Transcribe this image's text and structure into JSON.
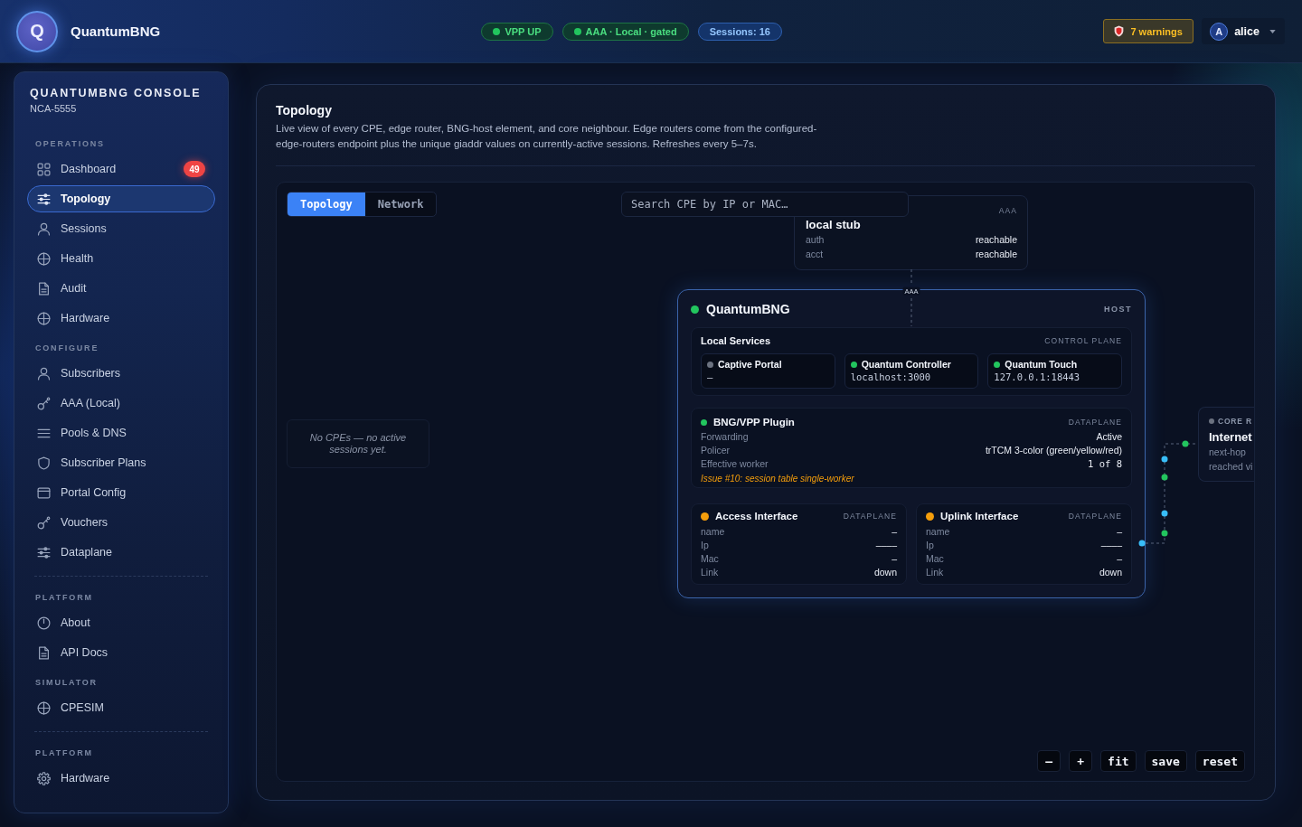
{
  "header": {
    "logo_letter": "Q",
    "brand": "QuantumBNG",
    "status_pills": [
      {
        "label": "VPP UP",
        "kind": "ok"
      },
      {
        "label": "AAA · Local · gated",
        "kind": "ok"
      },
      {
        "label": "Sessions: 16",
        "kind": "info"
      }
    ],
    "warnings": {
      "label": "7 warnings"
    },
    "user": {
      "initial": "A",
      "name": "alice"
    }
  },
  "sidebar": {
    "title": "QUANTUMBNG CONSOLE",
    "subtitle": "NCA-5555",
    "sections": [
      {
        "label": "OPERATIONS",
        "items": [
          {
            "label": "Dashboard",
            "selected": false,
            "badge": "49"
          },
          {
            "label": "Topology",
            "selected": true
          },
          {
            "label": "Sessions",
            "selected": false
          },
          {
            "label": "Health",
            "selected": false
          },
          {
            "label": "Audit",
            "selected": false
          },
          {
            "label": "Hardware",
            "selected": false
          }
        ]
      },
      {
        "label": "CONFIGURE",
        "items": [
          {
            "label": "Subscribers",
            "selected": false
          },
          {
            "label": "AAA (Local)",
            "selected": false
          },
          {
            "label": "Pools & DNS",
            "selected": false
          },
          {
            "label": "Subscriber Plans",
            "selected": false
          },
          {
            "label": "Portal Config",
            "selected": false
          },
          {
            "label": "Vouchers",
            "selected": false
          },
          {
            "label": "Dataplane",
            "selected": false
          }
        ]
      },
      {
        "label": "PLATFORM",
        "items": [
          {
            "label": "About",
            "selected": false
          },
          {
            "label": "API Docs",
            "selected": false
          }
        ]
      },
      {
        "label": "SIMULATOR",
        "items": [
          {
            "label": "CPESIM",
            "selected": false
          }
        ]
      },
      {
        "label": "PLATFORM",
        "items": [
          {
            "label": "Hardware",
            "selected": false
          }
        ]
      }
    ]
  },
  "topology": {
    "title": "Topology",
    "description": "Live view of every CPE, edge router, BNG-host element, and core neighbour. Edge routers come from the configured-edge-routers endpoint plus the unique giaddr values on currently-active sessions. Refreshes every 5–7s.",
    "view_tabs": [
      {
        "label": "Topology",
        "selected": true
      },
      {
        "label": "Network",
        "selected": false
      }
    ],
    "search": {
      "placeholder": "Search CPE by IP or MAC…"
    },
    "radius_server": {
      "tag": "AAA",
      "name": "local stub",
      "rows": [
        {
          "label": "auth",
          "value": "reachable"
        },
        {
          "label": "acct",
          "value": "reachable"
        }
      ]
    },
    "aaa_link": {
      "label": "AAA"
    },
    "host": {
      "name": "QuantumBNG",
      "color": "#22c55e",
      "tag": "HOST",
      "local_services": {
        "title": "Local Services",
        "tag": "CONTROL PLANE",
        "services": [
          {
            "name": "Captive Portal",
            "color": "#6b7280",
            "address": "–"
          },
          {
            "name": "Quantum Controller",
            "color": "#22c55e",
            "address": "localhost:3000"
          },
          {
            "name": "Quantum Touch",
            "color": "#22c55e",
            "address": "127.0.0.1:18443"
          }
        ]
      },
      "plugin": {
        "name": "BNG/VPP Plugin",
        "color": "#22c55e",
        "tag": "DATAPLANE",
        "rows": [
          {
            "label": "Forwarding",
            "value": "Active",
            "kind": "text"
          },
          {
            "label": "Policer",
            "value": "trTCM 3-color (green/yellow/red)",
            "kind": "text"
          },
          {
            "label": "Effective worker",
            "value": "1 of 8",
            "kind": "mono"
          }
        ],
        "note": "Issue #10: session table single-worker"
      },
      "interfaces": [
        {
          "name": "Access Interface",
          "color": "#f59e0b",
          "tag": "DATAPLANE",
          "rows": [
            {
              "label": "name",
              "value": "–"
            },
            {
              "label": "Ip",
              "value": "––––"
            },
            {
              "label": "Mac",
              "value": "–"
            },
            {
              "label": "Link",
              "value": "down"
            }
          ]
        },
        {
          "name": "Uplink Interface",
          "color": "#f59e0b",
          "tag": "DATAPLANE",
          "rows": [
            {
              "label": "name",
              "value": "–"
            },
            {
              "label": "Ip",
              "value": "––––"
            },
            {
              "label": "Mac",
              "value": "–"
            },
            {
              "label": "Link",
              "value": "down"
            }
          ]
        }
      ]
    },
    "uplink_link": {
      "packets": [
        {
          "color": "#38bdf8"
        },
        {
          "color": "#22c55e"
        },
        {
          "color": "#38bdf8"
        },
        {
          "color": "#22c55e"
        },
        {
          "color": "#38bdf8"
        },
        {
          "color": "#22c55e"
        }
      ]
    },
    "core_router": {
      "tag": "CORE R",
      "name": "Internet",
      "color": "#6b7280",
      "details": [
        "next-hop",
        "reached vi"
      ]
    },
    "cpe_list": {
      "empty_text": "No CPEs — no active sessions yet."
    },
    "controls": [
      "–",
      "+",
      "fit",
      "save",
      "reset"
    ]
  }
}
